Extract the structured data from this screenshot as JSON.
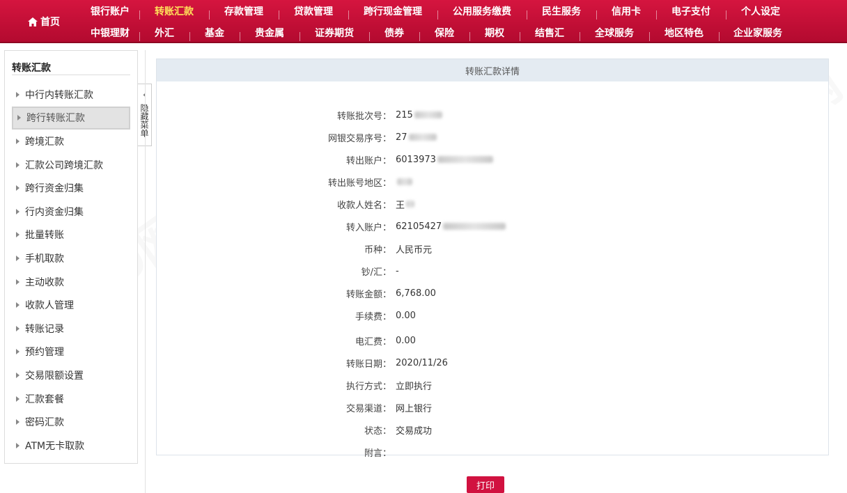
{
  "nav": {
    "home_label": "首页",
    "row1": [
      "银行账户",
      "转账汇款",
      "存款管理",
      "贷款管理",
      "跨行现金管理",
      "公用服务缴费",
      "民生服务",
      "信用卡",
      "电子支付",
      "个人设定"
    ],
    "row2": [
      "中银理财",
      "外汇",
      "基金",
      "贵金属",
      "证券期货",
      "债券",
      "保险",
      "期权",
      "结售汇",
      "全球服务",
      "地区特色",
      "企业家服务"
    ],
    "active": "转账汇款"
  },
  "sidebar": {
    "title": "转账汇款",
    "items": [
      {
        "label": "中行内转账汇款"
      },
      {
        "label": "跨行转账汇款"
      },
      {
        "label": "跨境汇款"
      },
      {
        "label": "汇款公司跨境汇款"
      },
      {
        "label": "跨行资金归集"
      },
      {
        "label": "行内资金归集"
      },
      {
        "label": "批量转账"
      },
      {
        "label": "手机取款"
      },
      {
        "label": "主动收款"
      },
      {
        "label": "收款人管理"
      },
      {
        "label": "转账记录"
      },
      {
        "label": "预约管理"
      },
      {
        "label": "交易限额设置"
      },
      {
        "label": "汇款套餐"
      },
      {
        "label": "密码汇款"
      },
      {
        "label": "ATM无卡取款"
      }
    ],
    "active_index": 1,
    "hide_tab_label": "隐藏菜单"
  },
  "detail": {
    "title": "转账汇款详情",
    "rows": [
      {
        "label": "转账批次号：",
        "value": "215"
      },
      {
        "label": "网银交易序号：",
        "value": "27"
      },
      {
        "label": "转出账户：",
        "value": "6013973"
      },
      {
        "label": "转出账号地区：",
        "value": ""
      },
      {
        "label": "收款人姓名：",
        "value": "王"
      },
      {
        "label": "转入账户：",
        "value": "62105427"
      },
      {
        "label": "币种：",
        "value": "人民币元"
      },
      {
        "label": "钞/汇：",
        "value": "-"
      },
      {
        "label": "转账金额：",
        "value": "6,768.00"
      },
      {
        "label": "手续费：",
        "value": "0.00"
      },
      {
        "label": "电汇费：",
        "value": "0.00"
      },
      {
        "label": "转账日期：",
        "value": "2020/11/26"
      },
      {
        "label": "执行方式：",
        "value": "立即执行"
      },
      {
        "label": "交易渠道：",
        "value": "网上银行"
      },
      {
        "label": "状态：",
        "value": "交易成功"
      },
      {
        "label": "附言：",
        "value": ""
      }
    ]
  },
  "print_label": "打印",
  "colors": {
    "brand_red": "#c8102e",
    "active_nav": "#ffe05a"
  }
}
